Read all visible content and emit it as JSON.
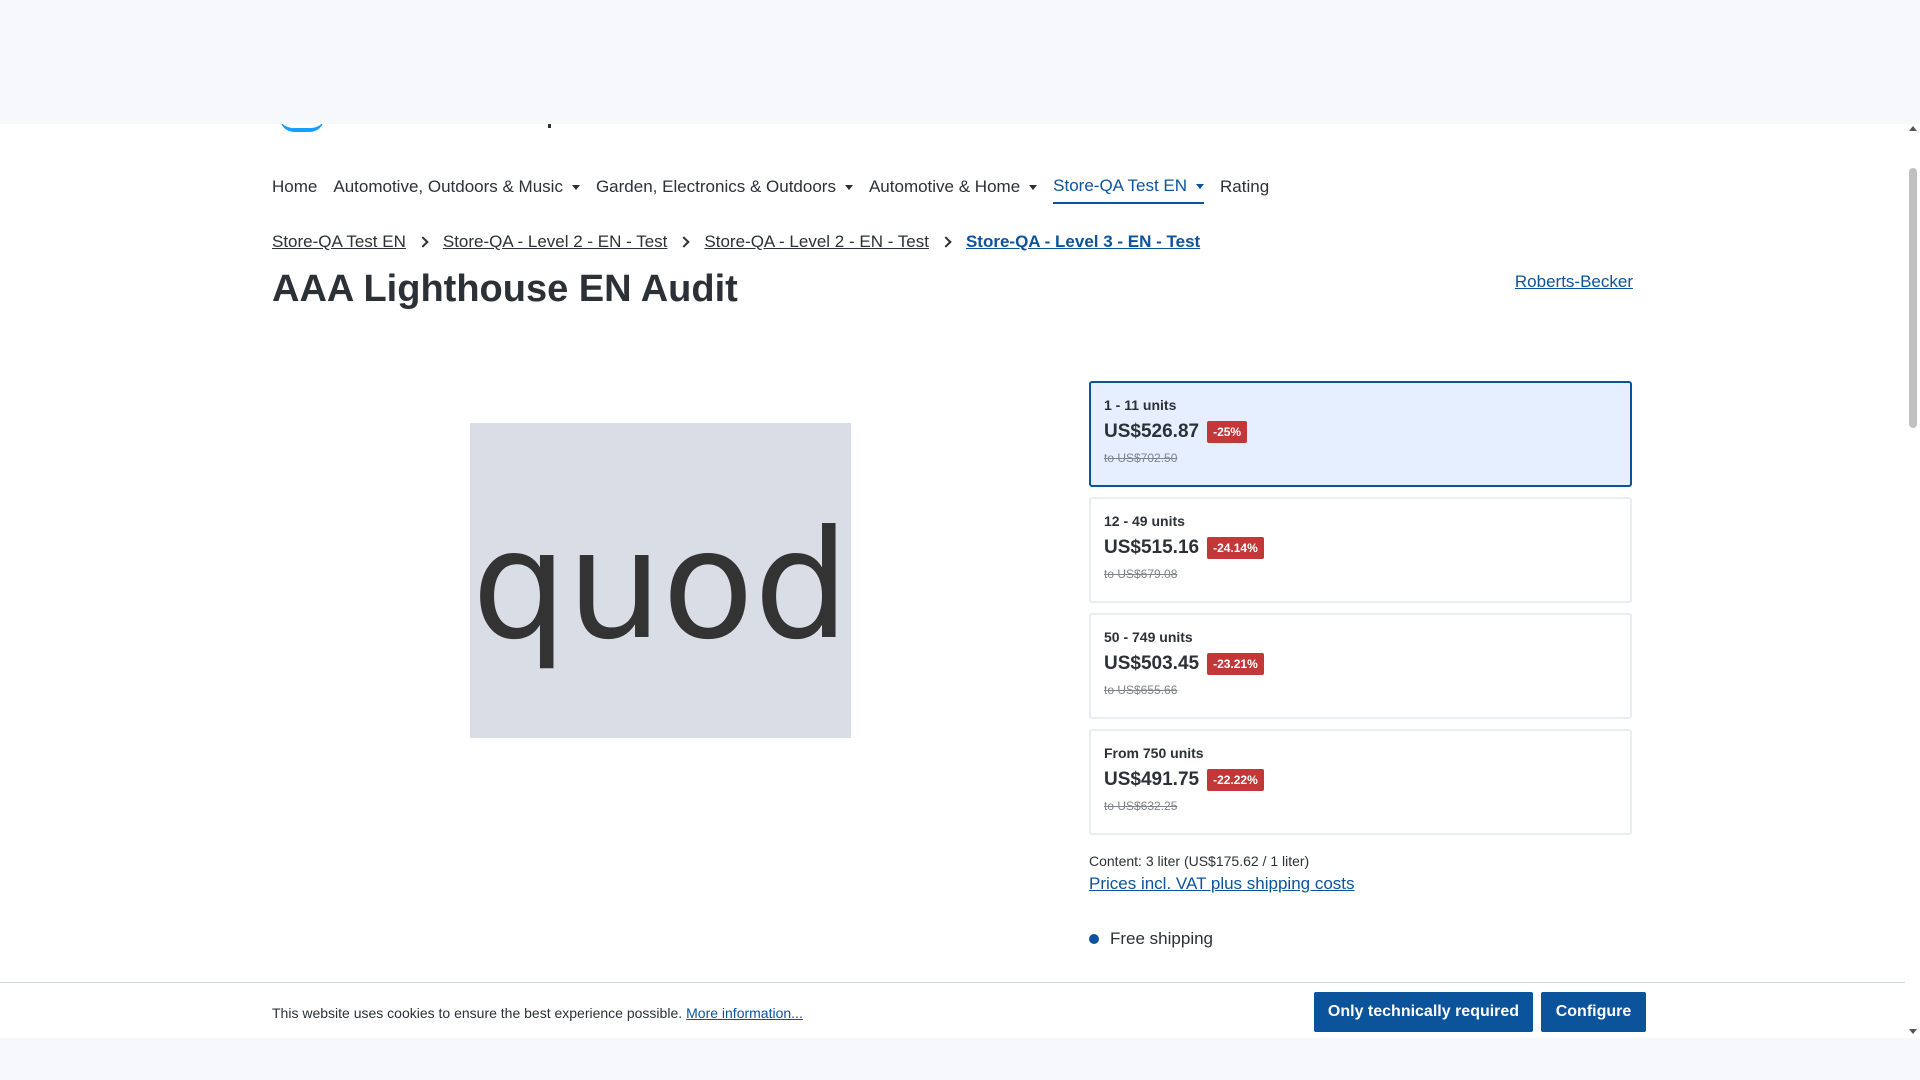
{
  "nav": {
    "items": [
      {
        "label": "Home",
        "dropdown": false
      },
      {
        "label": "Automotive, Outdoors & Music",
        "dropdown": true
      },
      {
        "label": "Garden, Electronics & Outdoors",
        "dropdown": true
      },
      {
        "label": "Automotive & Home",
        "dropdown": true
      },
      {
        "label": "Store-QA Test EN",
        "dropdown": true,
        "active": true
      },
      {
        "label": "Rating",
        "dropdown": false
      }
    ]
  },
  "breadcrumb": [
    "Store-QA Test EN",
    "Store-QA - Level 2 - EN - Test",
    "Store-QA - Level 2 - EN - Test",
    "Store-QA - Level 3 - EN - Test"
  ],
  "product": {
    "title": "AAA Lighthouse EN Audit",
    "manufacturer": "Roberts-Becker",
    "image_text": "quod"
  },
  "price_tiers": [
    {
      "qty": "1 - 11 units",
      "price": "US$526.87",
      "discount": "-25%",
      "reference": "to US$702.50",
      "selected": true
    },
    {
      "qty": "12 - 49 units",
      "price": "US$515.16",
      "discount": "-24.14%",
      "reference": "to US$679.08",
      "selected": false
    },
    {
      "qty": "50 - 749 units",
      "price": "US$503.45",
      "discount": "-23.21%",
      "reference": "to US$655.66",
      "selected": false
    },
    {
      "qty": "From 750 units",
      "price": "US$491.75",
      "discount": "-22.22%",
      "reference": "to US$632.25",
      "selected": false
    }
  ],
  "content_info": "Content: 3 liter (US$175.62 / 1 liter)",
  "vat_link": "Prices incl. VAT plus shipping costs",
  "shipping": "Free shipping",
  "cookie": {
    "text": "This website uses cookies to ensure the best experience possible.",
    "more_link": "More information...",
    "btn_required": "Only technically required",
    "btn_configure": "Configure"
  },
  "colors": {
    "primary": "#0b539b",
    "badge": "#c23838",
    "selected_bg": "#e5efff"
  }
}
